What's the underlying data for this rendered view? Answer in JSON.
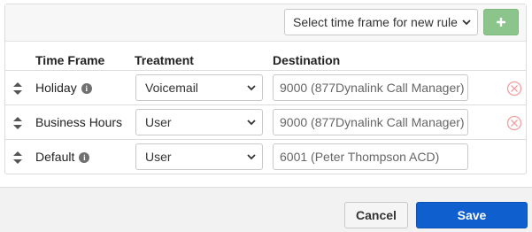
{
  "toolbar": {
    "timeframe_select_value": "Select time frame for new rule",
    "add_icon": "plus-icon"
  },
  "columns": {
    "time_frame": "Time Frame",
    "treatment": "Treatment",
    "destination": "Destination"
  },
  "rows": [
    {
      "time_frame": "Holiday",
      "has_info": true,
      "treatment": "Voicemail",
      "destination": "9000 (877Dynalink Call Manager)",
      "deletable": true
    },
    {
      "time_frame": "Business Hours",
      "has_info": false,
      "treatment": "User",
      "destination": "9000 (877Dynalink Call Manager)",
      "deletable": true
    },
    {
      "time_frame": "Default",
      "has_info": true,
      "treatment": "User",
      "destination": "6001 (Peter Thompson ACD)",
      "deletable": false
    }
  ],
  "footer": {
    "cancel_label": "Cancel",
    "save_label": "Save"
  },
  "colors": {
    "save": "#0f5fcf",
    "add": "#8bc58b",
    "delete": "#f0a0a0"
  }
}
